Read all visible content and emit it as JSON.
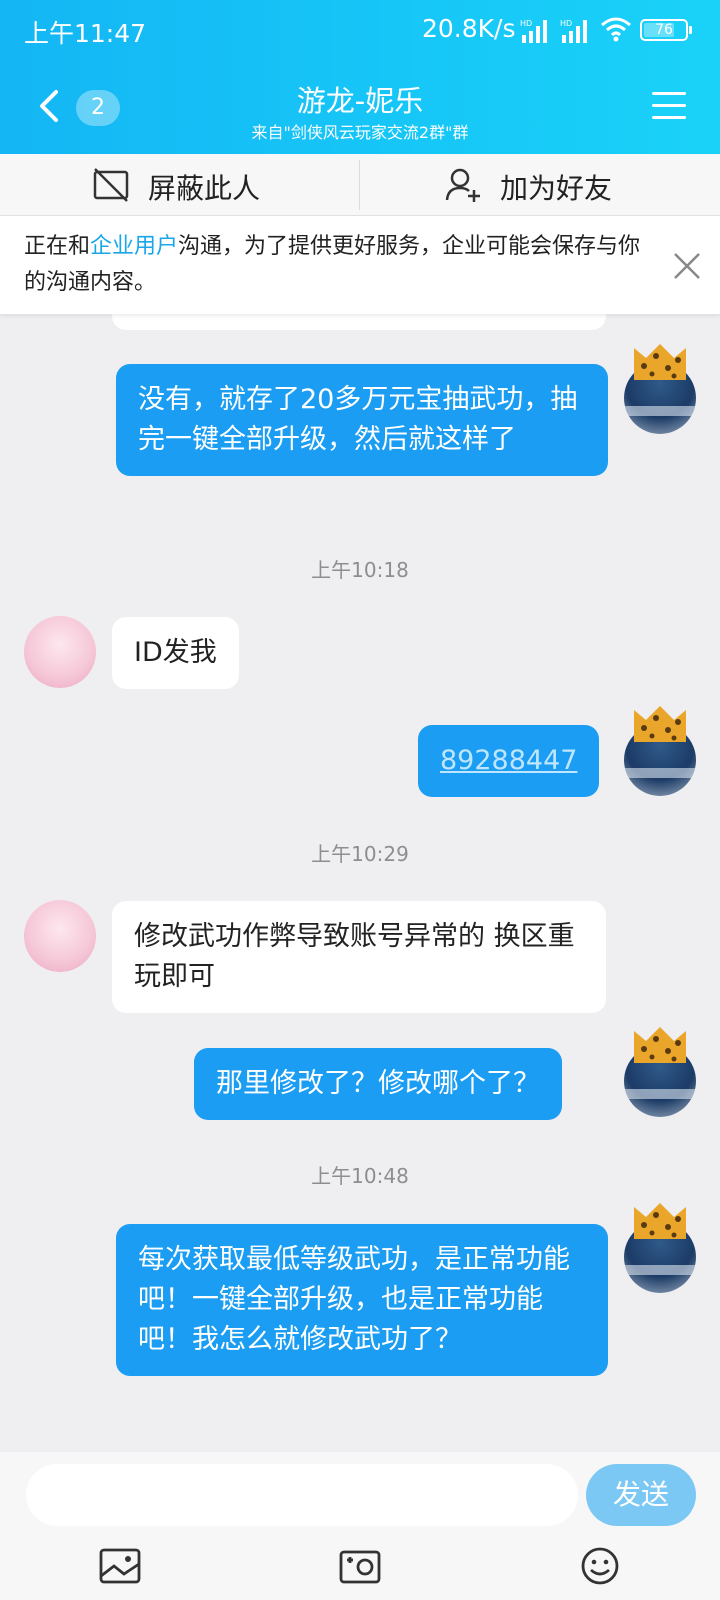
{
  "status_bar": {
    "time": "上午11:47",
    "network_speed": "20.8K/s",
    "battery": "76"
  },
  "header": {
    "unread_count": "2",
    "title": "游龙-妮乐",
    "subtitle": "来自\"剑侠风云玩家交流2群\"群"
  },
  "actions": {
    "block_label": "屏蔽此人",
    "add_friend_label": "加为好友"
  },
  "notice": {
    "prefix": "正在和",
    "highlight": "企业用户",
    "suffix": "沟通，为了提供更好服务，企业可能会保存与你的沟通内容。"
  },
  "colors": {
    "header_gradient_start": "#14b6f4",
    "my_bubble": "#1a9df3",
    "highlight": "#1aa7e8",
    "send_button": "#7cc8f5"
  },
  "messages": [
    {
      "from": "me",
      "text": "没有，就存了20多万元宝抽武功，抽完一键全部升级，然后就这样了"
    },
    {
      "timestamp": "上午10:18"
    },
    {
      "from": "them",
      "text": "ID发我"
    },
    {
      "from": "me",
      "text": "89288447"
    },
    {
      "timestamp": "上午10:29"
    },
    {
      "from": "them",
      "text": "修改武功作弊导致账号异常的 换区重玩即可"
    },
    {
      "from": "me",
      "text": "那里修改了？修改哪个了？"
    },
    {
      "timestamp": "上午10:48"
    },
    {
      "from": "me",
      "text": "每次获取最低等级武功，是正常功能吧！一键全部升级，也是正常功能吧！我怎么就修改武功了？"
    }
  ],
  "input": {
    "send_label": "发送"
  },
  "toolbar_icons": [
    "image-icon",
    "camera-icon",
    "emoji-icon"
  ]
}
